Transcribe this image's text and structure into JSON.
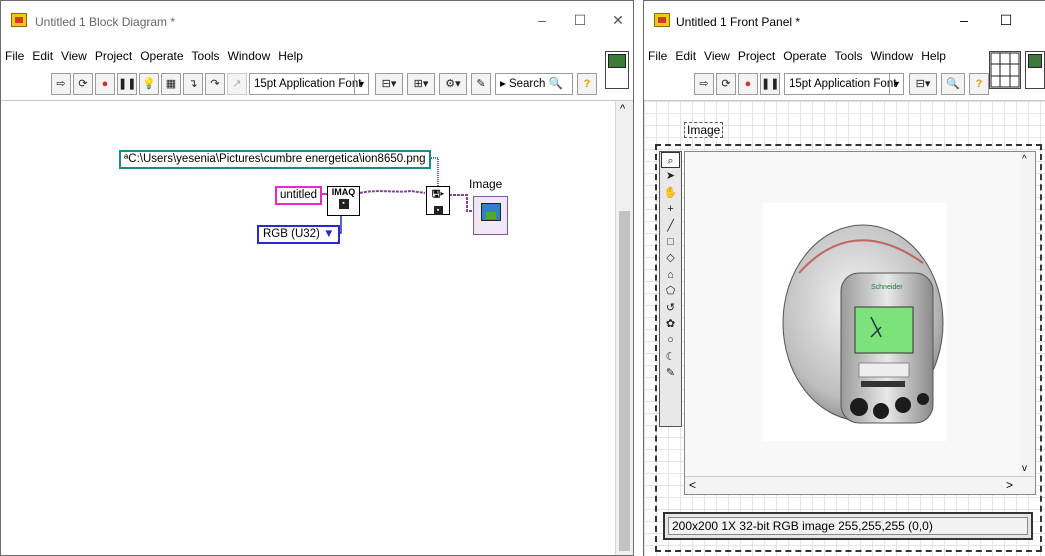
{
  "block_diagram": {
    "title": "Untitled 1 Block Diagram *",
    "window_controls": {
      "minimize": "–",
      "maximize": "☐",
      "close": "✕"
    },
    "menu": [
      "File",
      "Edit",
      "View",
      "Project",
      "Operate",
      "Tools",
      "Window",
      "Help"
    ],
    "font_select": "15pt Application Font",
    "search_label": "Search",
    "help_label": "?",
    "path_constant": "C:\\Users\\yesenia\\Pictures\\cumbre energetica\\ion8650.png",
    "string_constant": "untitled",
    "imaq_label": "IMAQ",
    "enum_constant": "RGB (U32)",
    "enum_arrow": "▼",
    "image_indicator_label": "Image",
    "scroll_up": "^"
  },
  "front_panel": {
    "title": "Untitled 1 Front Panel *",
    "window_controls": {
      "minimize": "–",
      "maximize": "☐",
      "close": "✕"
    },
    "menu": [
      "File",
      "Edit",
      "View",
      "Project",
      "Operate",
      "Tools",
      "Window",
      "Help"
    ],
    "font_select": "15pt Application Font",
    "help_label": "?",
    "image_label": "Image",
    "info_text": "200x200 1X 32-bit RGB image 255,255,255    (0,0)",
    "photo_brand": "Schneider",
    "scroll": {
      "left": "<",
      "right": ">",
      "up": "^",
      "down": "v"
    }
  },
  "colors": {
    "path_wire": "#1d8a84",
    "string_wire": "#e52ac9",
    "enum_wire": "#2a2acb",
    "image_wire": "#8b3f9c"
  }
}
